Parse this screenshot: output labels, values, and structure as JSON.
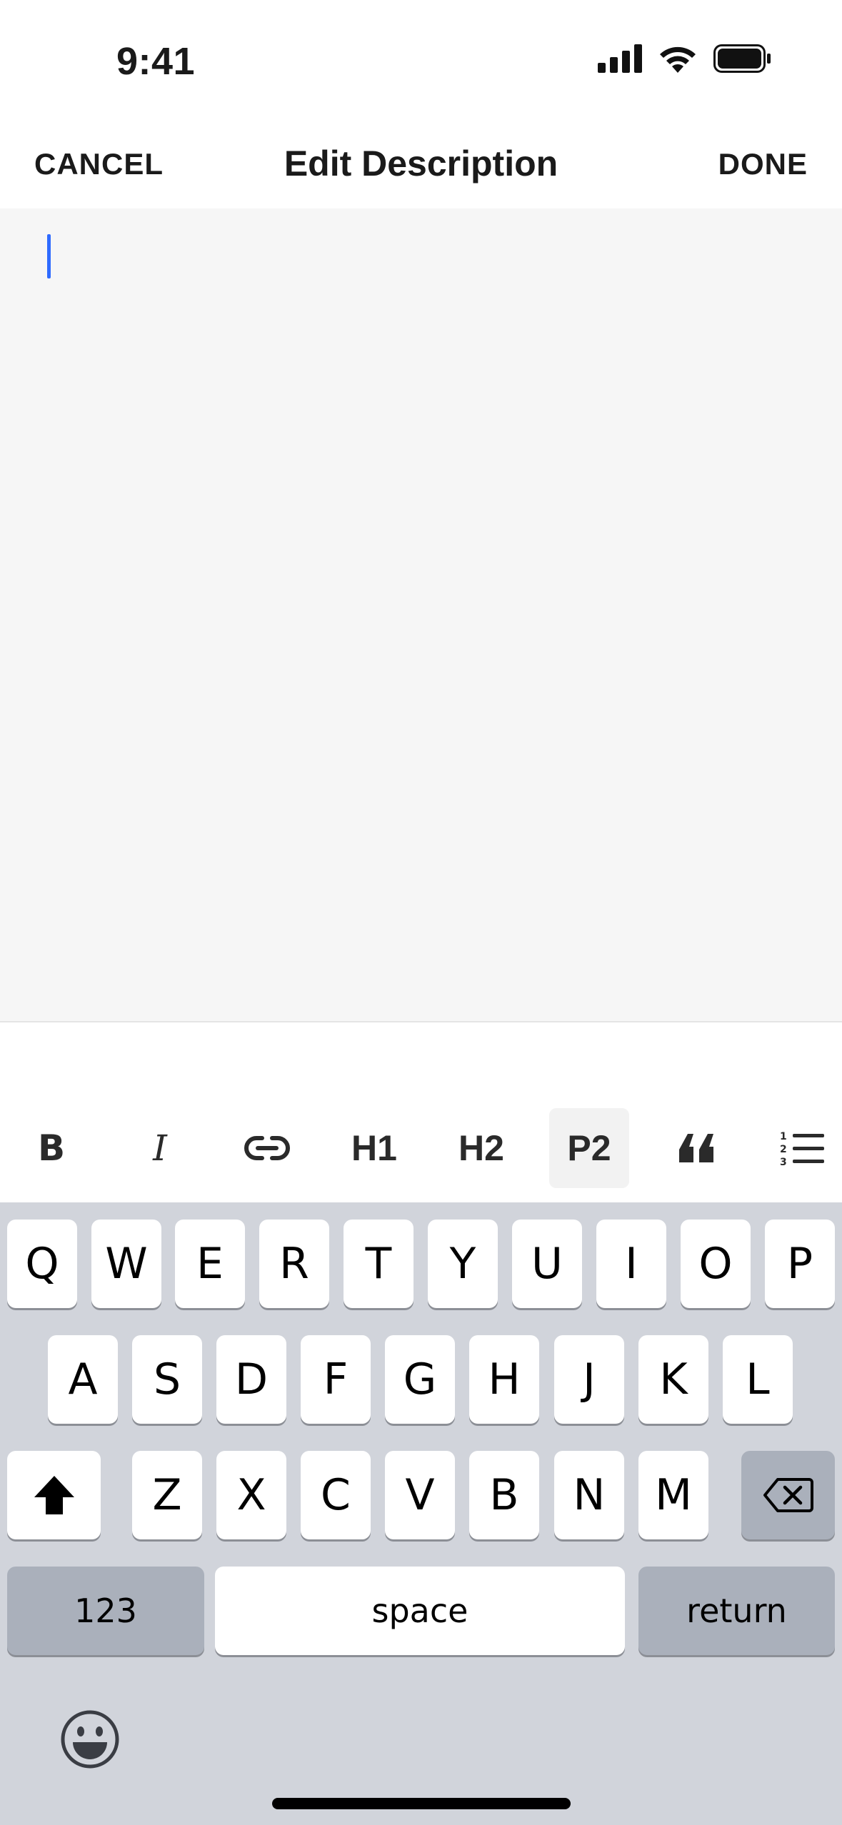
{
  "status_bar": {
    "time": "9:41"
  },
  "header": {
    "cancel_label": "CANCEL",
    "title": "Edit Description",
    "done_label": "DONE"
  },
  "editor": {
    "content": ""
  },
  "toolbar": {
    "bold_label": "B",
    "italic_label": "I",
    "h1_label": "H1",
    "h2_label": "H2",
    "p2_label": "P2",
    "quote_label": "❝",
    "active_tool": "P2"
  },
  "keyboard": {
    "row1": [
      "Q",
      "W",
      "E",
      "R",
      "T",
      "Y",
      "U",
      "I",
      "O",
      "P"
    ],
    "row2": [
      "A",
      "S",
      "D",
      "F",
      "G",
      "H",
      "J",
      "K",
      "L"
    ],
    "row3": [
      "Z",
      "X",
      "C",
      "V",
      "B",
      "N",
      "M"
    ],
    "numbers_label": "123",
    "space_label": "space",
    "return_label": "return"
  },
  "colors": {
    "caret": "#2f6bff",
    "keyboard_bg": "#d1d4db",
    "key_bg": "#ffffff",
    "key_gray": "#aab0bb"
  }
}
